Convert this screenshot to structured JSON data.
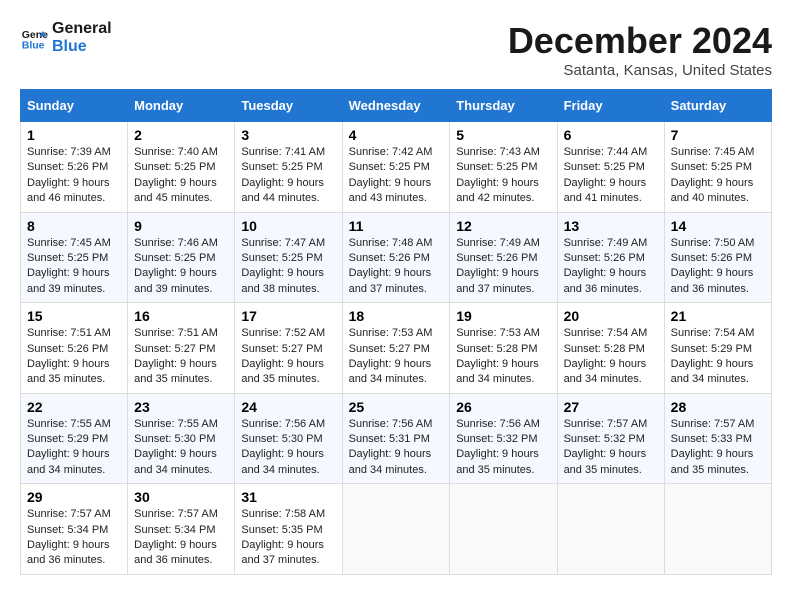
{
  "header": {
    "logo_line1": "General",
    "logo_line2": "Blue",
    "title": "December 2024",
    "subtitle": "Satanta, Kansas, United States"
  },
  "calendar": {
    "weekdays": [
      "Sunday",
      "Monday",
      "Tuesday",
      "Wednesday",
      "Thursday",
      "Friday",
      "Saturday"
    ],
    "weeks": [
      [
        {
          "day": "1",
          "sunrise": "Sunrise: 7:39 AM",
          "sunset": "Sunset: 5:26 PM",
          "daylight": "Daylight: 9 hours and 46 minutes."
        },
        {
          "day": "2",
          "sunrise": "Sunrise: 7:40 AM",
          "sunset": "Sunset: 5:25 PM",
          "daylight": "Daylight: 9 hours and 45 minutes."
        },
        {
          "day": "3",
          "sunrise": "Sunrise: 7:41 AM",
          "sunset": "Sunset: 5:25 PM",
          "daylight": "Daylight: 9 hours and 44 minutes."
        },
        {
          "day": "4",
          "sunrise": "Sunrise: 7:42 AM",
          "sunset": "Sunset: 5:25 PM",
          "daylight": "Daylight: 9 hours and 43 minutes."
        },
        {
          "day": "5",
          "sunrise": "Sunrise: 7:43 AM",
          "sunset": "Sunset: 5:25 PM",
          "daylight": "Daylight: 9 hours and 42 minutes."
        },
        {
          "day": "6",
          "sunrise": "Sunrise: 7:44 AM",
          "sunset": "Sunset: 5:25 PM",
          "daylight": "Daylight: 9 hours and 41 minutes."
        },
        {
          "day": "7",
          "sunrise": "Sunrise: 7:45 AM",
          "sunset": "Sunset: 5:25 PM",
          "daylight": "Daylight: 9 hours and 40 minutes."
        }
      ],
      [
        {
          "day": "8",
          "sunrise": "Sunrise: 7:45 AM",
          "sunset": "Sunset: 5:25 PM",
          "daylight": "Daylight: 9 hours and 39 minutes."
        },
        {
          "day": "9",
          "sunrise": "Sunrise: 7:46 AM",
          "sunset": "Sunset: 5:25 PM",
          "daylight": "Daylight: 9 hours and 39 minutes."
        },
        {
          "day": "10",
          "sunrise": "Sunrise: 7:47 AM",
          "sunset": "Sunset: 5:25 PM",
          "daylight": "Daylight: 9 hours and 38 minutes."
        },
        {
          "day": "11",
          "sunrise": "Sunrise: 7:48 AM",
          "sunset": "Sunset: 5:26 PM",
          "daylight": "Daylight: 9 hours and 37 minutes."
        },
        {
          "day": "12",
          "sunrise": "Sunrise: 7:49 AM",
          "sunset": "Sunset: 5:26 PM",
          "daylight": "Daylight: 9 hours and 37 minutes."
        },
        {
          "day": "13",
          "sunrise": "Sunrise: 7:49 AM",
          "sunset": "Sunset: 5:26 PM",
          "daylight": "Daylight: 9 hours and 36 minutes."
        },
        {
          "day": "14",
          "sunrise": "Sunrise: 7:50 AM",
          "sunset": "Sunset: 5:26 PM",
          "daylight": "Daylight: 9 hours and 36 minutes."
        }
      ],
      [
        {
          "day": "15",
          "sunrise": "Sunrise: 7:51 AM",
          "sunset": "Sunset: 5:26 PM",
          "daylight": "Daylight: 9 hours and 35 minutes."
        },
        {
          "day": "16",
          "sunrise": "Sunrise: 7:51 AM",
          "sunset": "Sunset: 5:27 PM",
          "daylight": "Daylight: 9 hours and 35 minutes."
        },
        {
          "day": "17",
          "sunrise": "Sunrise: 7:52 AM",
          "sunset": "Sunset: 5:27 PM",
          "daylight": "Daylight: 9 hours and 35 minutes."
        },
        {
          "day": "18",
          "sunrise": "Sunrise: 7:53 AM",
          "sunset": "Sunset: 5:27 PM",
          "daylight": "Daylight: 9 hours and 34 minutes."
        },
        {
          "day": "19",
          "sunrise": "Sunrise: 7:53 AM",
          "sunset": "Sunset: 5:28 PM",
          "daylight": "Daylight: 9 hours and 34 minutes."
        },
        {
          "day": "20",
          "sunrise": "Sunrise: 7:54 AM",
          "sunset": "Sunset: 5:28 PM",
          "daylight": "Daylight: 9 hours and 34 minutes."
        },
        {
          "day": "21",
          "sunrise": "Sunrise: 7:54 AM",
          "sunset": "Sunset: 5:29 PM",
          "daylight": "Daylight: 9 hours and 34 minutes."
        }
      ],
      [
        {
          "day": "22",
          "sunrise": "Sunrise: 7:55 AM",
          "sunset": "Sunset: 5:29 PM",
          "daylight": "Daylight: 9 hours and 34 minutes."
        },
        {
          "day": "23",
          "sunrise": "Sunrise: 7:55 AM",
          "sunset": "Sunset: 5:30 PM",
          "daylight": "Daylight: 9 hours and 34 minutes."
        },
        {
          "day": "24",
          "sunrise": "Sunrise: 7:56 AM",
          "sunset": "Sunset: 5:30 PM",
          "daylight": "Daylight: 9 hours and 34 minutes."
        },
        {
          "day": "25",
          "sunrise": "Sunrise: 7:56 AM",
          "sunset": "Sunset: 5:31 PM",
          "daylight": "Daylight: 9 hours and 34 minutes."
        },
        {
          "day": "26",
          "sunrise": "Sunrise: 7:56 AM",
          "sunset": "Sunset: 5:32 PM",
          "daylight": "Daylight: 9 hours and 35 minutes."
        },
        {
          "day": "27",
          "sunrise": "Sunrise: 7:57 AM",
          "sunset": "Sunset: 5:32 PM",
          "daylight": "Daylight: 9 hours and 35 minutes."
        },
        {
          "day": "28",
          "sunrise": "Sunrise: 7:57 AM",
          "sunset": "Sunset: 5:33 PM",
          "daylight": "Daylight: 9 hours and 35 minutes."
        }
      ],
      [
        {
          "day": "29",
          "sunrise": "Sunrise: 7:57 AM",
          "sunset": "Sunset: 5:34 PM",
          "daylight": "Daylight: 9 hours and 36 minutes."
        },
        {
          "day": "30",
          "sunrise": "Sunrise: 7:57 AM",
          "sunset": "Sunset: 5:34 PM",
          "daylight": "Daylight: 9 hours and 36 minutes."
        },
        {
          "day": "31",
          "sunrise": "Sunrise: 7:58 AM",
          "sunset": "Sunset: 5:35 PM",
          "daylight": "Daylight: 9 hours and 37 minutes."
        },
        null,
        null,
        null,
        null
      ]
    ]
  }
}
